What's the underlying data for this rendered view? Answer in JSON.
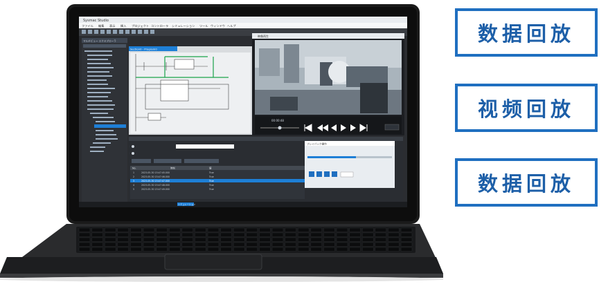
{
  "features": [
    {
      "label": "数据回放"
    },
    {
      "label": "视频回放"
    },
    {
      "label": "数据回放"
    }
  ],
  "screen": {
    "window_title": "Sysmac Studio",
    "menu_items": [
      "ファイル",
      "編集",
      "表示",
      "挿入",
      "プロジェクト",
      "コントローラ",
      "シミュレーション",
      "ツール",
      "ウィンドウ",
      "ヘルプ"
    ],
    "tree_title": "マルチビュー エクスプローラ",
    "program_tab": "Section0 - Program0",
    "video_title": "映像再生",
    "video_time": "00:00:48",
    "dialog_title": "プレイバック操作",
    "table_headers": [
      "No.",
      "時刻",
      "値"
    ],
    "table_rows": [
      [
        "1",
        "2023-05-30 15:47:45.000",
        "True"
      ],
      [
        "2",
        "2023-05-30 15:47:46.000",
        "True"
      ],
      [
        "3",
        "2023-05-30 15:47:47.000",
        "True"
      ],
      [
        "4",
        "2023-05-30 15:47:48.000",
        "True"
      ],
      [
        "5",
        "2023-05-30 15:47:49.000",
        "True"
      ]
    ],
    "status_text": "シミュレーション"
  },
  "colors": {
    "accent": "#1f6fc0",
    "feature_text": "#1d5fa8",
    "selection": "#1e7fd6"
  }
}
